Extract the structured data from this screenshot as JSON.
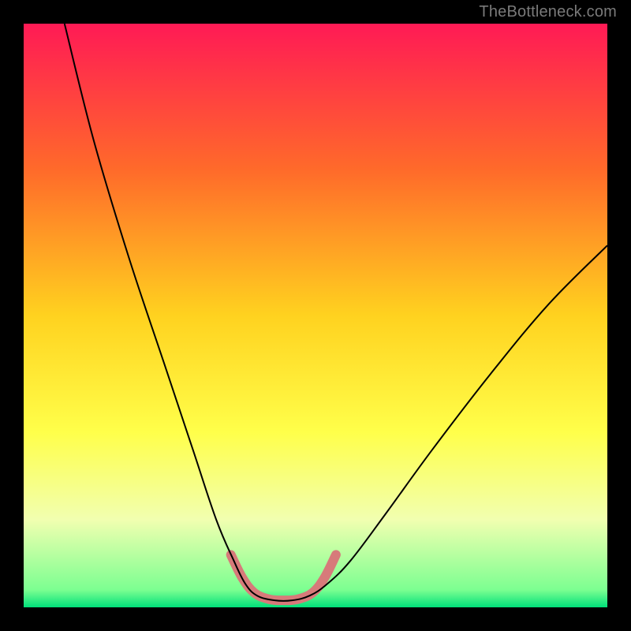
{
  "watermark": "TheBottleneck.com",
  "chart_data": {
    "type": "line",
    "title": "",
    "xlabel": "",
    "ylabel": "",
    "xlim": [
      0,
      100
    ],
    "ylim": [
      0,
      100
    ],
    "background_gradient": {
      "stops": [
        {
          "offset": 0,
          "color": "#ff1a55"
        },
        {
          "offset": 25,
          "color": "#ff6a2a"
        },
        {
          "offset": 50,
          "color": "#ffd21f"
        },
        {
          "offset": 70,
          "color": "#ffff4a"
        },
        {
          "offset": 85,
          "color": "#f1ffb0"
        },
        {
          "offset": 97,
          "color": "#7cff91"
        },
        {
          "offset": 100,
          "color": "#00e07a"
        }
      ]
    },
    "series": [
      {
        "name": "bottleneck-curve",
        "stroke": "#000000",
        "points": [
          {
            "x": 7,
            "y": 100
          },
          {
            "x": 12,
            "y": 80
          },
          {
            "x": 18,
            "y": 60
          },
          {
            "x": 24,
            "y": 42
          },
          {
            "x": 29,
            "y": 27
          },
          {
            "x": 33,
            "y": 15
          },
          {
            "x": 36,
            "y": 8
          },
          {
            "x": 38,
            "y": 4
          },
          {
            "x": 40,
            "y": 2
          },
          {
            "x": 43,
            "y": 1.2
          },
          {
            "x": 46,
            "y": 1.2
          },
          {
            "x": 49,
            "y": 2
          },
          {
            "x": 52,
            "y": 4
          },
          {
            "x": 56,
            "y": 8
          },
          {
            "x": 62,
            "y": 16
          },
          {
            "x": 70,
            "y": 27
          },
          {
            "x": 80,
            "y": 40
          },
          {
            "x": 90,
            "y": 52
          },
          {
            "x": 100,
            "y": 62
          }
        ]
      },
      {
        "name": "highlight-band",
        "stroke": "#d77a7a",
        "stroke_width": 12,
        "points": [
          {
            "x": 35.5,
            "y": 9
          },
          {
            "x": 37.5,
            "y": 5
          },
          {
            "x": 39.5,
            "y": 2.5
          },
          {
            "x": 42,
            "y": 1.4
          },
          {
            "x": 44.5,
            "y": 1.2
          },
          {
            "x": 47,
            "y": 1.4
          },
          {
            "x": 49.5,
            "y": 2.5
          },
          {
            "x": 51.5,
            "y": 5
          },
          {
            "x": 53.5,
            "y": 9
          }
        ]
      }
    ]
  }
}
